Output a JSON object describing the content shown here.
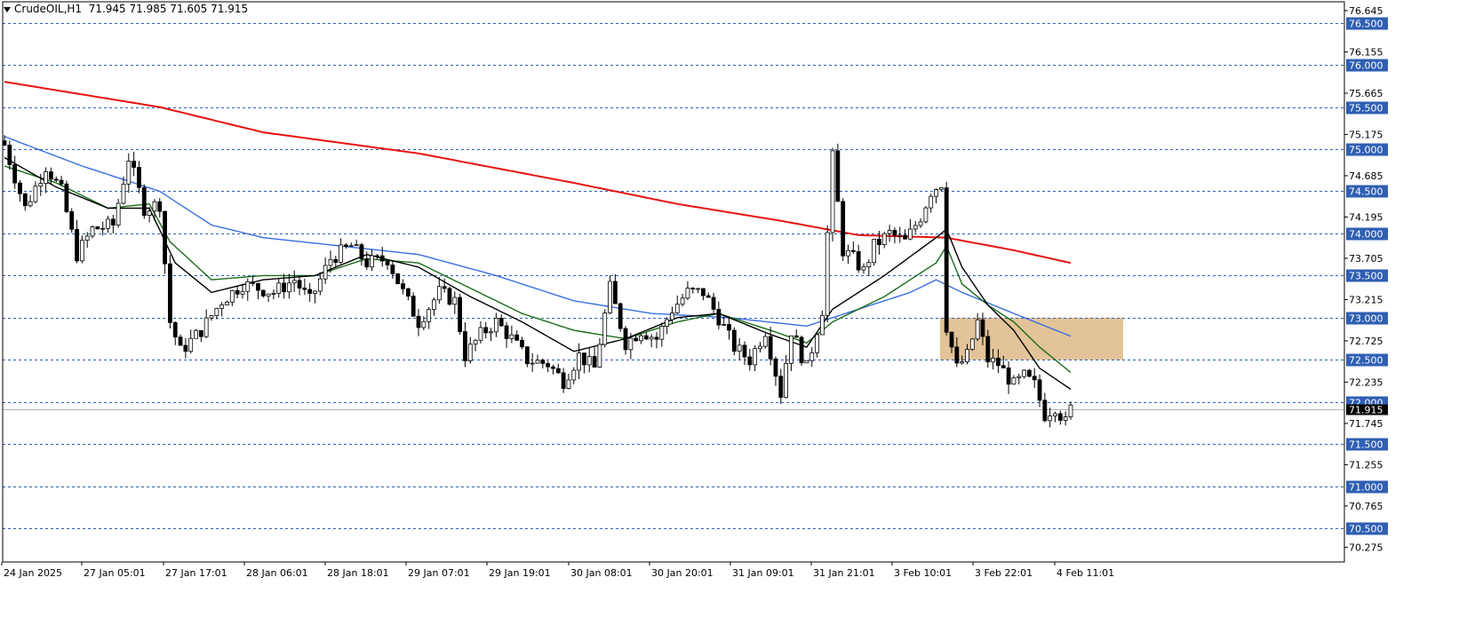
{
  "header": {
    "symbol": "CrudeOIL,H1",
    "ohlc": "71.945 71.985 71.605 71.915"
  },
  "colors": {
    "background": "#ffffff",
    "grid_level": "#2f5fb3",
    "ma_long": "#e81010",
    "ma_mid_blue": "#3a6fe0",
    "ma_green": "#1a6b1a",
    "ma_black": "#000000",
    "zone": "#deb887",
    "current_price_line": "#b0b0b0"
  },
  "chart_data": {
    "type": "candlestick",
    "title": "CrudeOIL,H1",
    "ylim": [
      70.1,
      76.75
    ],
    "price_axis_ticks": [
      "76.645",
      "76.155",
      "75.665",
      "75.175",
      "74.685",
      "74.195",
      "73.705",
      "73.215",
      "72.725",
      "72.235",
      "71.745",
      "71.255",
      "70.765",
      "70.275"
    ],
    "levels": [
      "76.500",
      "76.000",
      "75.500",
      "75.000",
      "74.500",
      "74.000",
      "73.500",
      "73.000",
      "72.500",
      "72.000",
      "71.500",
      "71.000",
      "70.500"
    ],
    "current_price": "71.915",
    "time_labels": [
      "24 Jan 2025",
      "27 Jan 05:01",
      "27 Jan 17:01",
      "28 Jan 06:01",
      "28 Jan 18:01",
      "29 Jan 07:01",
      "29 Jan 19:01",
      "30 Jan 08:01",
      "30 Jan 20:01",
      "31 Jan 09:01",
      "31 Jan 21:01",
      "3 Feb 10:01",
      "3 Feb 22:01",
      "4 Feb 11:01"
    ],
    "zone": {
      "from_label": "3 Feb 10:01",
      "top": 73.0,
      "bottom": 72.5
    },
    "close_path": [
      {
        "i": 0,
        "y": 75.05
      },
      {
        "i": 4,
        "y": 74.3
      },
      {
        "i": 8,
        "y": 74.8
      },
      {
        "i": 11,
        "y": 74.5
      },
      {
        "i": 14,
        "y": 73.75
      },
      {
        "i": 17,
        "y": 74.05
      },
      {
        "i": 21,
        "y": 74.1
      },
      {
        "i": 24,
        "y": 74.9
      },
      {
        "i": 27,
        "y": 74.3
      },
      {
        "i": 30,
        "y": 74.35
      },
      {
        "i": 32,
        "y": 72.95
      },
      {
        "i": 34,
        "y": 72.6
      },
      {
        "i": 38,
        "y": 72.85
      },
      {
        "i": 42,
        "y": 73.2
      },
      {
        "i": 46,
        "y": 73.4
      },
      {
        "i": 49,
        "y": 73.35
      },
      {
        "i": 52,
        "y": 73.3
      },
      {
        "i": 56,
        "y": 73.45
      },
      {
        "i": 59,
        "y": 73.2
      },
      {
        "i": 63,
        "y": 73.7
      },
      {
        "i": 67,
        "y": 73.85
      },
      {
        "i": 70,
        "y": 73.65
      },
      {
        "i": 74,
        "y": 73.7
      },
      {
        "i": 77,
        "y": 73.3
      },
      {
        "i": 80,
        "y": 72.95
      },
      {
        "i": 84,
        "y": 73.3
      },
      {
        "i": 87,
        "y": 73.2
      },
      {
        "i": 89,
        "y": 72.55
      },
      {
        "i": 92,
        "y": 72.8
      },
      {
        "i": 95,
        "y": 72.95
      },
      {
        "i": 98,
        "y": 72.75
      },
      {
        "i": 101,
        "y": 72.5
      },
      {
        "i": 105,
        "y": 72.45
      },
      {
        "i": 108,
        "y": 72.25
      },
      {
        "i": 111,
        "y": 72.55
      },
      {
        "i": 114,
        "y": 72.4
      },
      {
        "i": 117,
        "y": 73.35
      },
      {
        "i": 120,
        "y": 72.7
      },
      {
        "i": 123,
        "y": 72.85
      },
      {
        "i": 126,
        "y": 72.75
      },
      {
        "i": 129,
        "y": 73.1
      },
      {
        "i": 132,
        "y": 73.3
      },
      {
        "i": 135,
        "y": 73.3
      },
      {
        "i": 138,
        "y": 73.0
      },
      {
        "i": 141,
        "y": 72.65
      },
      {
        "i": 144,
        "y": 72.5
      },
      {
        "i": 147,
        "y": 72.85
      },
      {
        "i": 150,
        "y": 72.1
      },
      {
        "i": 152,
        "y": 72.85
      },
      {
        "i": 155,
        "y": 72.4
      },
      {
        "i": 158,
        "y": 73.1
      },
      {
        "i": 160,
        "y": 74.9
      },
      {
        "i": 162,
        "y": 73.8
      },
      {
        "i": 164,
        "y": 73.7
      },
      {
        "i": 166,
        "y": 73.55
      },
      {
        "i": 168,
        "y": 73.85
      },
      {
        "i": 171,
        "y": 74.0
      },
      {
        "i": 174,
        "y": 73.9
      },
      {
        "i": 177,
        "y": 74.2
      },
      {
        "i": 179,
        "y": 74.5
      },
      {
        "i": 181,
        "y": 74.6
      },
      {
        "i": 182,
        "y": 72.9
      },
      {
        "i": 184,
        "y": 72.4
      },
      {
        "i": 186,
        "y": 72.55
      },
      {
        "i": 188,
        "y": 72.95
      },
      {
        "i": 190,
        "y": 72.5
      },
      {
        "i": 192,
        "y": 72.45
      },
      {
        "i": 195,
        "y": 72.2
      },
      {
        "i": 197,
        "y": 72.3
      },
      {
        "i": 199,
        "y": 72.2
      },
      {
        "i": 201,
        "y": 71.85
      },
      {
        "i": 203,
        "y": 71.95
      },
      {
        "i": 205,
        "y": 71.75
      },
      {
        "i": 206,
        "y": 71.915
      }
    ],
    "ma_long": [
      {
        "i": 0,
        "y": 75.8
      },
      {
        "i": 10,
        "y": 75.7
      },
      {
        "i": 30,
        "y": 75.5
      },
      {
        "i": 50,
        "y": 75.2
      },
      {
        "i": 80,
        "y": 74.95
      },
      {
        "i": 110,
        "y": 74.6
      },
      {
        "i": 130,
        "y": 74.35
      },
      {
        "i": 150,
        "y": 74.15
      },
      {
        "i": 165,
        "y": 73.98
      },
      {
        "i": 182,
        "y": 73.95
      },
      {
        "i": 195,
        "y": 73.8
      },
      {
        "i": 206,
        "y": 73.65
      }
    ],
    "ma_mid": [
      {
        "i": 0,
        "y": 75.15
      },
      {
        "i": 15,
        "y": 74.8
      },
      {
        "i": 30,
        "y": 74.5
      },
      {
        "i": 40,
        "y": 74.1
      },
      {
        "i": 50,
        "y": 73.95
      },
      {
        "i": 65,
        "y": 73.85
      },
      {
        "i": 80,
        "y": 73.75
      },
      {
        "i": 95,
        "y": 73.5
      },
      {
        "i": 110,
        "y": 73.2
      },
      {
        "i": 125,
        "y": 73.05
      },
      {
        "i": 140,
        "y": 73.0
      },
      {
        "i": 155,
        "y": 72.9
      },
      {
        "i": 165,
        "y": 73.1
      },
      {
        "i": 175,
        "y": 73.3
      },
      {
        "i": 180,
        "y": 73.45
      },
      {
        "i": 185,
        "y": 73.3
      },
      {
        "i": 195,
        "y": 73.05
      },
      {
        "i": 206,
        "y": 72.78
      }
    ],
    "ma_green": [
      {
        "i": 0,
        "y": 74.8
      },
      {
        "i": 10,
        "y": 74.6
      },
      {
        "i": 20,
        "y": 74.3
      },
      {
        "i": 28,
        "y": 74.35
      },
      {
        "i": 32,
        "y": 73.9
      },
      {
        "i": 40,
        "y": 73.45
      },
      {
        "i": 50,
        "y": 73.5
      },
      {
        "i": 60,
        "y": 73.5
      },
      {
        "i": 70,
        "y": 73.7
      },
      {
        "i": 80,
        "y": 73.65
      },
      {
        "i": 90,
        "y": 73.35
      },
      {
        "i": 100,
        "y": 73.05
      },
      {
        "i": 110,
        "y": 72.85
      },
      {
        "i": 120,
        "y": 72.75
      },
      {
        "i": 130,
        "y": 72.95
      },
      {
        "i": 138,
        "y": 73.05
      },
      {
        "i": 148,
        "y": 72.85
      },
      {
        "i": 155,
        "y": 72.7
      },
      {
        "i": 160,
        "y": 72.95
      },
      {
        "i": 170,
        "y": 73.25
      },
      {
        "i": 180,
        "y": 73.65
      },
      {
        "i": 182,
        "y": 73.85
      },
      {
        "i": 185,
        "y": 73.4
      },
      {
        "i": 190,
        "y": 73.15
      },
      {
        "i": 195,
        "y": 72.95
      },
      {
        "i": 200,
        "y": 72.65
      },
      {
        "i": 206,
        "y": 72.35
      }
    ],
    "ma_black": [
      {
        "i": 0,
        "y": 74.9
      },
      {
        "i": 10,
        "y": 74.55
      },
      {
        "i": 20,
        "y": 74.3
      },
      {
        "i": 28,
        "y": 74.3
      },
      {
        "i": 33,
        "y": 73.65
      },
      {
        "i": 40,
        "y": 73.3
      },
      {
        "i": 50,
        "y": 73.45
      },
      {
        "i": 60,
        "y": 73.5
      },
      {
        "i": 70,
        "y": 73.75
      },
      {
        "i": 80,
        "y": 73.6
      },
      {
        "i": 90,
        "y": 73.25
      },
      {
        "i": 100,
        "y": 72.95
      },
      {
        "i": 110,
        "y": 72.6
      },
      {
        "i": 120,
        "y": 72.75
      },
      {
        "i": 130,
        "y": 73.0
      },
      {
        "i": 138,
        "y": 73.05
      },
      {
        "i": 148,
        "y": 72.8
      },
      {
        "i": 155,
        "y": 72.65
      },
      {
        "i": 160,
        "y": 73.1
      },
      {
        "i": 170,
        "y": 73.5
      },
      {
        "i": 180,
        "y": 73.95
      },
      {
        "i": 182,
        "y": 74.05
      },
      {
        "i": 185,
        "y": 73.6
      },
      {
        "i": 190,
        "y": 73.15
      },
      {
        "i": 195,
        "y": 72.85
      },
      {
        "i": 200,
        "y": 72.4
      },
      {
        "i": 206,
        "y": 72.15
      }
    ]
  }
}
